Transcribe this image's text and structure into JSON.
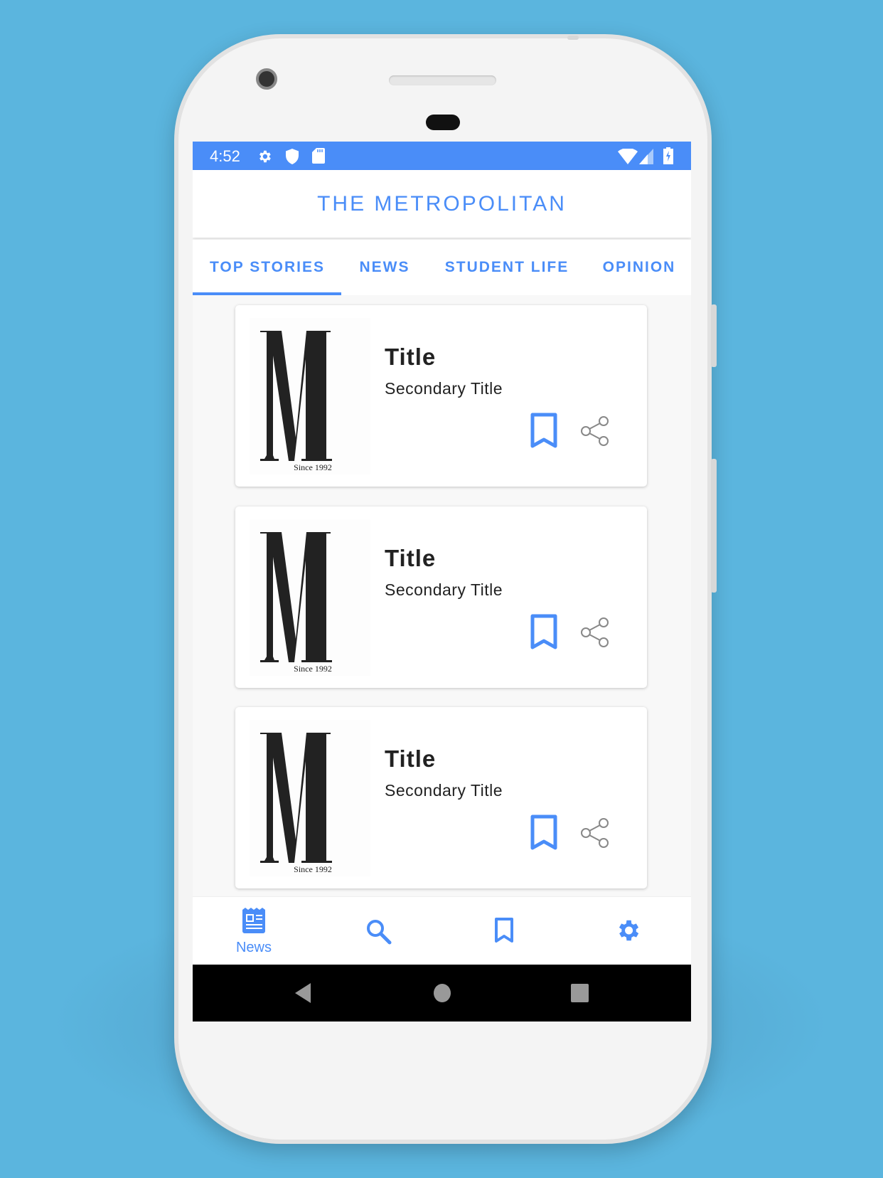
{
  "status_bar": {
    "time": "4:52",
    "icons": [
      "gear-icon",
      "shield-icon",
      "sd-card-icon",
      "wifi-icon",
      "signal-icon",
      "battery-charging-icon"
    ]
  },
  "header": {
    "title": "THE METROPOLITAN"
  },
  "tabs": [
    {
      "label": "TOP STORIES",
      "selected": true
    },
    {
      "label": "NEWS",
      "selected": false
    },
    {
      "label": "STUDENT LIFE",
      "selected": false
    },
    {
      "label": "OPINION",
      "selected": false
    }
  ],
  "articles": [
    {
      "title": "Title",
      "subtitle": "Secondary Title",
      "logo_text": "Since 1992"
    },
    {
      "title": "Title",
      "subtitle": "Secondary Title",
      "logo_text": "Since 1992"
    },
    {
      "title": "Title",
      "subtitle": "Secondary Title",
      "logo_text": "Since 1992"
    }
  ],
  "bottom_nav": [
    {
      "label": "News",
      "icon": "newspaper-icon",
      "selected": true
    },
    {
      "icon": "search-icon"
    },
    {
      "icon": "bookmark-icon"
    },
    {
      "icon": "gear-icon"
    }
  ],
  "colors": {
    "accent": "#4a8df8",
    "background": "#5bb5de"
  }
}
